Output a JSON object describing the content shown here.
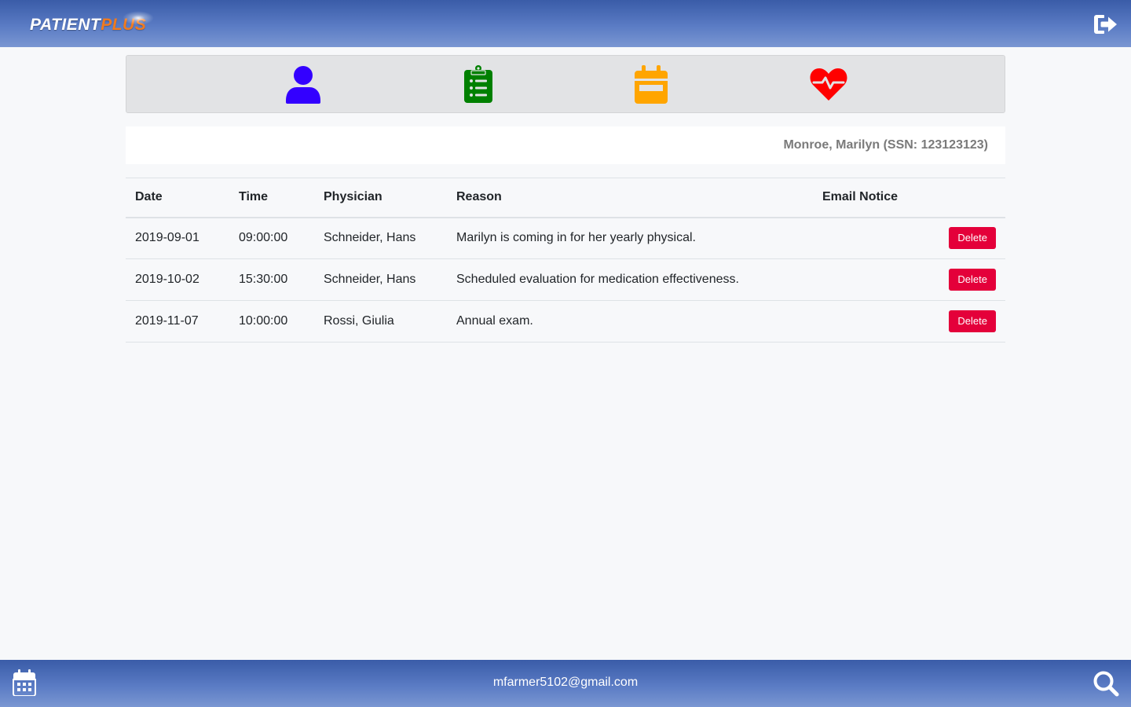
{
  "header": {
    "logo_word1": "PATIENT",
    "logo_word2": "PLUS",
    "logout_icon": "sign-out-icon"
  },
  "nav": {
    "items": [
      {
        "icon": "user-icon",
        "color": "#3300ff"
      },
      {
        "icon": "clipboard-list-icon",
        "color": "#008000"
      },
      {
        "icon": "calendar-icon",
        "color": "#ffa500"
      },
      {
        "icon": "heartbeat-icon",
        "color": "#ff0000"
      }
    ]
  },
  "patient": {
    "display": "Monroe, Marilyn (SSN: 123123123)"
  },
  "table": {
    "headers": {
      "date": "Date",
      "time": "Time",
      "physician": "Physician",
      "reason": "Reason",
      "email_notice": "Email Notice"
    },
    "rows": [
      {
        "date": "2019-09-01",
        "time": "09:00:00",
        "physician": "Schneider, Hans",
        "reason": "Marilyn is coming in for her yearly physical.",
        "email_notice": "",
        "action": "Delete"
      },
      {
        "date": "2019-10-02",
        "time": "15:30:00",
        "physician": "Schneider, Hans",
        "reason": "Scheduled evaluation for medication effectiveness.",
        "email_notice": "",
        "action": "Delete"
      },
      {
        "date": "2019-11-07",
        "time": "10:00:00",
        "physician": "Rossi, Giulia",
        "reason": "Annual exam.",
        "email_notice": "",
        "action": "Delete"
      }
    ]
  },
  "footer": {
    "email": "mfarmer5102@gmail.com",
    "left_icon": "calendar-icon",
    "right_icon": "search-icon"
  },
  "colors": {
    "bar_gradient_top": "#3a5ca8",
    "bar_gradient_bottom": "#7a96d2",
    "delete_button": "#e4003a",
    "logo_accent": "#f07a1f"
  }
}
